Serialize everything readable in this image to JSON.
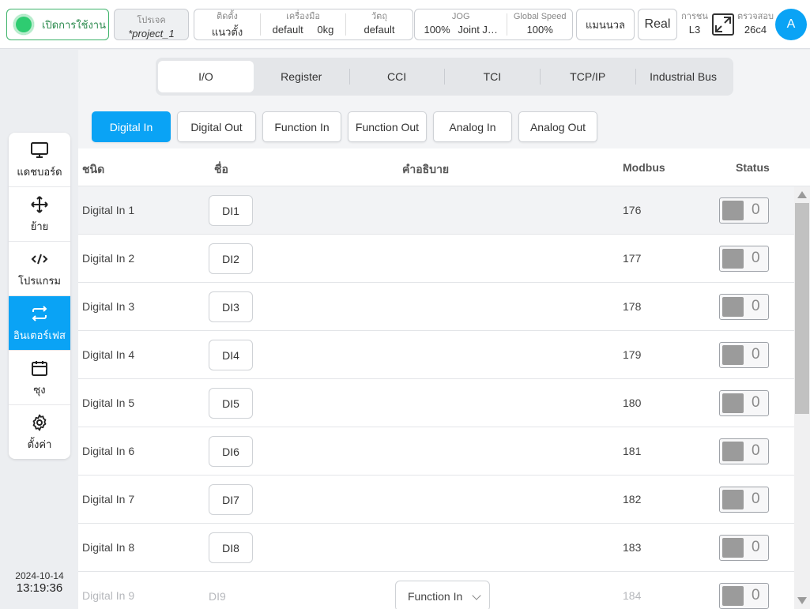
{
  "topbar": {
    "power_label": "เปิดการใช้งาน",
    "project_label": "โปรเจค",
    "project_value": "*project_1",
    "install_label": "ติดตั้ง",
    "install_value": "แนวตั้ง",
    "tool_label": "เครื่องมือ",
    "tool_value": "default",
    "tool_weight": "0kg",
    "object_label": "วัตถุ",
    "object_value": "default",
    "jog_label": "JOG",
    "jog_value": "100%",
    "jog_mode": "Joint J…",
    "speed_label": "Global Speed",
    "speed_value": "100%",
    "mode_label": "แมนนวล",
    "real_label": "Real",
    "collision_label": "การชน",
    "collision_value": "L3",
    "verify_label": "ตรวจสอบ",
    "verify_value": "26c4",
    "avatar_letter": "A"
  },
  "sidebar": {
    "items": [
      {
        "label": "แดชบอร์ด",
        "icon": "monitor-icon"
      },
      {
        "label": "ย้าย",
        "icon": "move-icon"
      },
      {
        "label": "โปรแกรม",
        "icon": "code-icon"
      },
      {
        "label": "อินเตอร์เฟส",
        "icon": "interface-icon",
        "active": true
      },
      {
        "label": "ซุง",
        "icon": "calendar-icon"
      },
      {
        "label": "ตั้งค่า",
        "icon": "gear-icon"
      }
    ],
    "date": "2024-10-14",
    "time": "13:19:36"
  },
  "tabs": [
    "I/O",
    "Register",
    "CCI",
    "TCI",
    "TCP/IP",
    "Industrial Bus"
  ],
  "active_tab": "I/O",
  "subtabs": [
    "Digital In",
    "Digital Out",
    "Function In",
    "Function Out",
    "Analog In",
    "Analog Out"
  ],
  "active_subtab": "Digital In",
  "table": {
    "headers": {
      "type": "ชนิด",
      "name": "ชื่อ",
      "desc": "คำอธิบาย",
      "modbus": "Modbus",
      "status": "Status"
    },
    "rows": [
      {
        "type": "Digital In 1",
        "name": "DI1",
        "modbus": "176",
        "status": "0"
      },
      {
        "type": "Digital In 2",
        "name": "DI2",
        "modbus": "177",
        "status": "0"
      },
      {
        "type": "Digital In 3",
        "name": "DI3",
        "modbus": "178",
        "status": "0"
      },
      {
        "type": "Digital In 4",
        "name": "DI4",
        "modbus": "179",
        "status": "0"
      },
      {
        "type": "Digital In 5",
        "name": "DI5",
        "modbus": "180",
        "status": "0"
      },
      {
        "type": "Digital In 6",
        "name": "DI6",
        "modbus": "181",
        "status": "0"
      },
      {
        "type": "Digital In 7",
        "name": "DI7",
        "modbus": "182",
        "status": "0"
      },
      {
        "type": "Digital In 8",
        "name": "DI8",
        "modbus": "183",
        "status": "0"
      },
      {
        "type": "Digital In 9",
        "name": "DI9",
        "modbus": "184",
        "status": "0",
        "function": "Function In"
      }
    ]
  },
  "colors": {
    "accent": "#0aa3f5",
    "power": "#2ecc71"
  }
}
